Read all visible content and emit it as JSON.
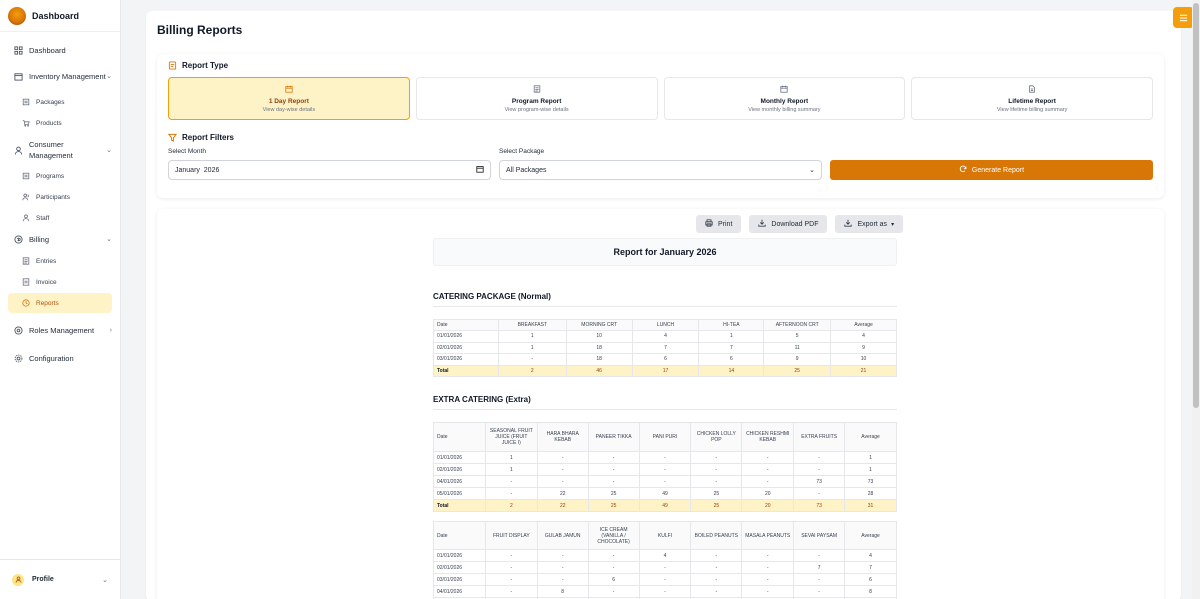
{
  "brand": {
    "title": "Dashboard"
  },
  "sidebar": {
    "items": [
      {
        "label": "Dashboard"
      },
      {
        "label": "Inventory Management",
        "children": [
          "Packages",
          "Products"
        ]
      },
      {
        "label": "Consumer Management",
        "children": [
          "Programs",
          "Participants",
          "Staff"
        ]
      },
      {
        "label": "Billing",
        "children": [
          "Entries",
          "Invoice",
          "Reports"
        ]
      },
      {
        "label": "Roles Management"
      },
      {
        "label": "Configuration"
      }
    ],
    "active_item": "Reports"
  },
  "profile": {
    "label": "Profile"
  },
  "page": {
    "title": "Billing Reports"
  },
  "report_type": {
    "heading": "Report Type",
    "options": [
      {
        "title": "1 Day Report",
        "desc": "View day-wise details",
        "active": true
      },
      {
        "title": "Program Report",
        "desc": "View program-wise details",
        "active": false
      },
      {
        "title": "Monthly Report",
        "desc": "View monthly billing summary",
        "active": false
      },
      {
        "title": "Lifetime Report",
        "desc": "View lifetime billing summary",
        "active": false
      }
    ]
  },
  "filters": {
    "heading": "Report Filters",
    "month_label": "Select Month",
    "month_value": "January  2026",
    "package_label": "Select Package",
    "package_value": "All Packages",
    "generate_label": "Generate Report"
  },
  "toolbar": {
    "print": "Print",
    "download": "Download PDF",
    "export": "Export as"
  },
  "report": {
    "title": "Report for January 2026",
    "tables": [
      {
        "title": "CATERING PACKAGE (Normal)",
        "headers": [
          "Date",
          "BREAKFAST",
          "MORNING CRT",
          "LUNCH",
          "HI-TEA",
          "AFTERNOON CRT",
          "Average"
        ],
        "rows": [
          [
            "01/01/2026",
            "1",
            "10",
            "4",
            "1",
            "5",
            "4"
          ],
          [
            "02/01/2026",
            "1",
            "18",
            "7",
            "7",
            "11",
            "9"
          ],
          [
            "03/01/2026",
            "-",
            "18",
            "6",
            "6",
            "9",
            "10"
          ]
        ],
        "total": [
          "Total",
          "2",
          "46",
          "17",
          "14",
          "25",
          "21"
        ]
      },
      {
        "title": "EXTRA CATERING (Extra)",
        "headers": [
          "Date",
          "SEASONAL FRUIT JUICE (FRUIT JUICE I)",
          "HARA BHARA KEBAB",
          "PANEER TIKKA",
          "PANI PURI",
          "CHICKEN LOLLY POP",
          "CHICKEN RESHMI KEBAB",
          "EXTRA FRUITS",
          "Average"
        ],
        "rows": [
          [
            "01/01/2026",
            "1",
            "-",
            "-",
            "-",
            "-",
            "-",
            "-",
            "1"
          ],
          [
            "02/01/2026",
            "1",
            "-",
            "-",
            "-",
            "-",
            "-",
            "-",
            "1"
          ],
          [
            "04/01/2026",
            "-",
            "-",
            "-",
            "-",
            "-",
            "-",
            "73",
            "73"
          ],
          [
            "05/01/2026",
            "-",
            "22",
            "25",
            "49",
            "25",
            "20",
            "-",
            "28"
          ]
        ],
        "total": [
          "Total",
          "2",
          "22",
          "25",
          "49",
          "25",
          "20",
          "73",
          "31"
        ]
      },
      {
        "title": "",
        "headers": [
          "Date",
          "FRUIT DISPLAY",
          "GULAB JAMUN",
          "ICE CREAM (VANILLA / CHOCOLATE)",
          "KULFI",
          "BOILED PEANUTS",
          "MASALA PEANUTS",
          "SEVAI PAYSAM",
          "Average"
        ],
        "rows": [
          [
            "01/01/2026",
            "-",
            "-",
            "-",
            "4",
            "-",
            "-",
            "-",
            "4"
          ],
          [
            "02/01/2026",
            "-",
            "-",
            "-",
            "-",
            "-",
            "-",
            "7",
            "7"
          ],
          [
            "03/01/2026",
            "-",
            "-",
            "6",
            "-",
            "-",
            "-",
            "-",
            "6"
          ],
          [
            "04/01/2026",
            "-",
            "8",
            "-",
            "-",
            "-",
            "-",
            "-",
            "8"
          ],
          [
            "05/01/2026",
            "22",
            "-",
            "-",
            "-",
            "10",
            "12",
            "-",
            "15"
          ]
        ]
      }
    ]
  }
}
